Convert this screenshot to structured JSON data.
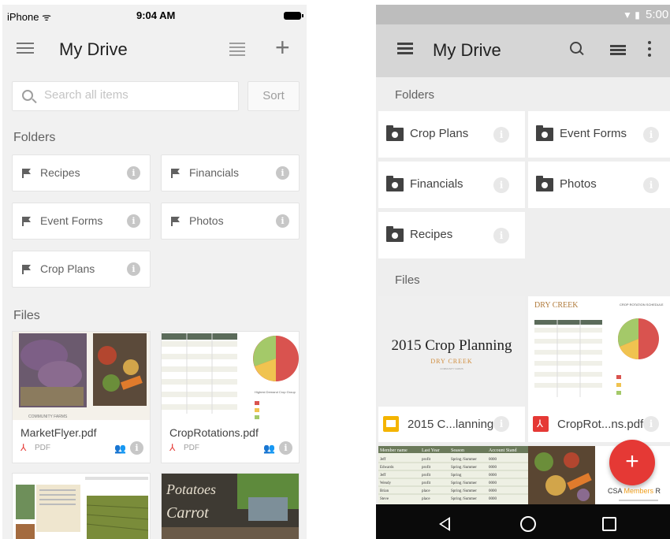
{
  "colors": {
    "pdf_red": "#e53935",
    "slides_yellow": "#f4b400",
    "fab_red": "#e53935"
  },
  "ios": {
    "status": {
      "carrier": "iPhone ᯤ",
      "time": "9:04 AM"
    },
    "toolbar": {
      "menu_icon": "menu-icon",
      "title": "My Drive",
      "list_icon": "list-view-icon",
      "add_label": "+"
    },
    "search": {
      "placeholder": "Search all items"
    },
    "sort_label": "Sort",
    "folders_header": "Folders",
    "folders": [
      {
        "name": "Recipes"
      },
      {
        "name": "Financials"
      },
      {
        "name": "Event Forms"
      },
      {
        "name": "Photos"
      },
      {
        "name": "Crop Plans"
      }
    ],
    "files_header": "Files",
    "files": [
      {
        "name": "MarketFlyer.pdf",
        "type": "PDF"
      },
      {
        "name": "CropRotations.pdf",
        "type": "PDF"
      }
    ],
    "thumb_text": {
      "croprot_header": "Highest Demand Crop Group",
      "flyer_caption": "COMMUNITY FARMS",
      "potatoes": "Potatoes",
      "carrots": "Carrot"
    }
  },
  "android": {
    "status": {
      "time": "5:00"
    },
    "toolbar": {
      "title": "My Drive"
    },
    "folders_header": "Folders",
    "folders": [
      {
        "name": "Crop Plans"
      },
      {
        "name": "Event Forms"
      },
      {
        "name": "Financials"
      },
      {
        "name": "Photos"
      },
      {
        "name": "Recipes"
      }
    ],
    "files_header": "Files",
    "files": [
      {
        "name": "2015 C...lanning",
        "kind": "slides"
      },
      {
        "name": "CropRot...ns.pdf",
        "kind": "pdf"
      }
    ],
    "thumb_text": {
      "crop_planning_title": "2015 Crop Planning",
      "crop_planning_brand": "DRY CREEK",
      "crop_planning_sub": "COMMUNITY FARMS",
      "croprot_brand": "DRY CREEK",
      "croprot_head": "CROP ROTATION SCHEDULE",
      "sheet_headers": [
        "Member name",
        "Last Year",
        "Season",
        "Account Stand"
      ],
      "sheet_rows": [
        [
          "Jeff",
          "profit",
          "Spring /Summer",
          "0000"
        ],
        [
          "Edwards",
          "profit",
          "Spring /Summer",
          "0000"
        ],
        [
          "Jeff",
          "profit",
          "Spring",
          "0000"
        ],
        [
          "Wendy",
          "profit",
          "Spring /Summer",
          "0000"
        ],
        [
          "Brian",
          "place",
          "Spring /Summer",
          "0000"
        ],
        [
          "Steve",
          "place",
          "Spring /Summer",
          "0000"
        ]
      ],
      "csa_title_a": "CSA ",
      "csa_title_b": "Members",
      "csa_title_c": " R"
    },
    "fab_label": "+",
    "nav": {
      "back": "back-icon",
      "home": "home-icon",
      "recent": "recents-icon"
    }
  }
}
